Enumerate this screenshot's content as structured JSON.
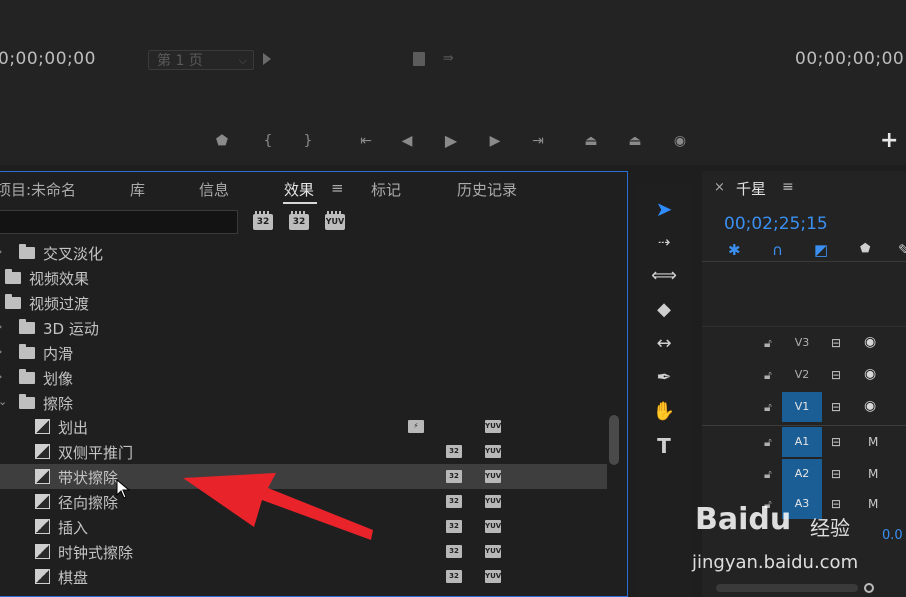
{
  "monitor": {
    "timecode_left": "0;00;00;00",
    "timecode_right": "00;00;00;00",
    "page_select": "第 1 页",
    "controls": [
      "add-marker",
      "mark-in",
      "mark-out",
      "go-to-in",
      "step-back",
      "play",
      "step-forward",
      "go-to-out",
      "lift",
      "extract",
      "export-frame"
    ],
    "add_button": "+"
  },
  "effects_panel": {
    "tabs": [
      {
        "label": "项目:未命名",
        "active": false
      },
      {
        "label": "库",
        "active": false
      },
      {
        "label": "信息",
        "active": false
      },
      {
        "label": "效果",
        "active": true
      },
      {
        "label": "标记",
        "active": false
      },
      {
        "label": "历史记录",
        "active": false
      }
    ],
    "tab_menu_glyph": "≡",
    "search": {
      "value": "",
      "placeholder": ""
    },
    "filter_badges": [
      "32",
      "32",
      "YUV"
    ],
    "tree": [
      {
        "label": "交叉淡化",
        "kind": "folder",
        "level": 1,
        "expanded": false
      },
      {
        "label": "视频效果",
        "kind": "folder",
        "level": 0,
        "expanded": false
      },
      {
        "label": "视频过渡",
        "kind": "folder",
        "level": 0,
        "expanded": true
      },
      {
        "label": "3D 运动",
        "kind": "folder",
        "level": 1,
        "expanded": false
      },
      {
        "label": "内滑",
        "kind": "folder",
        "level": 1,
        "expanded": false
      },
      {
        "label": "划像",
        "kind": "folder",
        "level": 1,
        "expanded": false
      },
      {
        "label": "擦除",
        "kind": "folder",
        "level": 1,
        "expanded": true
      },
      {
        "label": "划出",
        "kind": "effect",
        "badges": [
          "acc",
          "yuv"
        ]
      },
      {
        "label": "双侧平推门",
        "kind": "effect",
        "badges": [
          "32",
          "yuv"
        ]
      },
      {
        "label": "带状擦除",
        "kind": "effect",
        "badges": [
          "32",
          "yuv"
        ],
        "selected": true
      },
      {
        "label": "径向擦除",
        "kind": "effect",
        "badges": [
          "32",
          "yuv"
        ]
      },
      {
        "label": "插入",
        "kind": "effect",
        "badges": [
          "32",
          "yuv"
        ]
      },
      {
        "label": "时钟式擦除",
        "kind": "effect",
        "badges": [
          "32",
          "yuv"
        ]
      },
      {
        "label": "棋盘",
        "kind": "effect",
        "badges": [
          "32",
          "yuv"
        ]
      }
    ]
  },
  "tools": [
    "selection-tool",
    "track-select-tool",
    "ripple-edit-tool",
    "razor-tool",
    "slip-tool",
    "pen-tool",
    "hand-tool",
    "type-tool"
  ],
  "timeline": {
    "close_glyph": "×",
    "sequence_name": "千星",
    "menu_glyph": "≡",
    "timecode": "00;02;25;15",
    "tracks": [
      {
        "name": "V3",
        "type": "video",
        "targeted": false
      },
      {
        "name": "V2",
        "type": "video",
        "targeted": false
      },
      {
        "name": "V1",
        "type": "video",
        "targeted": true
      },
      {
        "name": "A1",
        "type": "audio",
        "targeted": true,
        "mute_label": "M"
      },
      {
        "name": "A2",
        "type": "audio",
        "targeted": true,
        "mute_label": "M"
      },
      {
        "name": "A3",
        "type": "audio",
        "targeted": true,
        "mute_label": "M"
      }
    ],
    "audio_value": "0.0"
  },
  "watermark": {
    "brand": "Baidu",
    "brand_sub": "经验",
    "url": "jingyan.baidu.com"
  },
  "colors": {
    "accent_blue": "#2f8cff",
    "panel_focus_border": "#2d6cd0",
    "annotation_arrow": "#e8232a",
    "track_target": "#1b5e96"
  }
}
